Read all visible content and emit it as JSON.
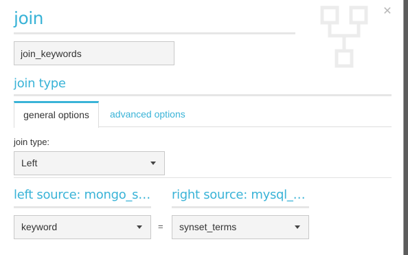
{
  "dialog": {
    "title": "join",
    "close_icon": "close-icon",
    "decor_icon": "join-diagram-icon",
    "name_value": "join_keywords"
  },
  "join_section": {
    "title": "join type",
    "tabs": [
      {
        "label": "general options",
        "active": true
      },
      {
        "label": "advanced options",
        "active": false
      }
    ],
    "join_type_label": "join type:",
    "join_type_value": "Left"
  },
  "sources": {
    "left_title": "left source: mongo_sel...",
    "right_title": "right source: mysql_se...",
    "left_key": "keyword",
    "operator": "=",
    "right_key": "synset_terms"
  },
  "colors": {
    "accent": "#39b3d7",
    "field_bg": "#f4f4f4",
    "rule": "#e6e6e6"
  }
}
